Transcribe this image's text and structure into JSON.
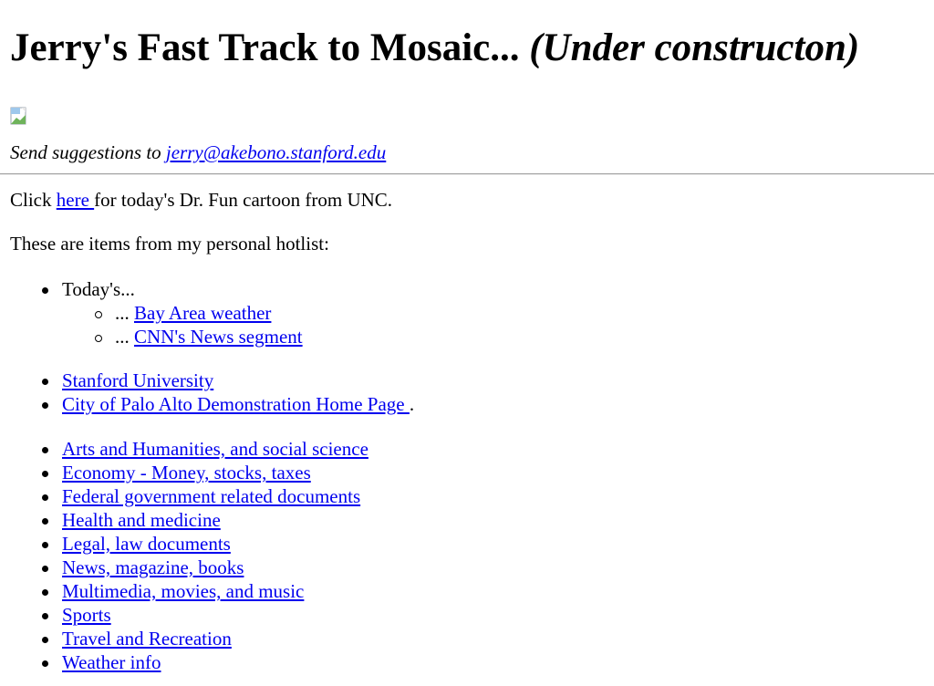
{
  "header": {
    "title_main": "Jerry's Fast Track to Mosaic...",
    "title_sub": "(Under constructon)"
  },
  "image": {
    "icon": "broken-image-icon"
  },
  "suggest": {
    "prefix": "Send suggestions to ",
    "email": "jerry@akebono.stanford.edu"
  },
  "cartoon": {
    "prefix": "Click ",
    "link": "here ",
    "suffix": "for today's Dr. Fun cartoon from UNC."
  },
  "hotlist_intro": "These are items from my personal hotlist:",
  "today": {
    "label": "Today's...",
    "items": [
      {
        "prefix": "... ",
        "link": "Bay Area weather"
      },
      {
        "prefix": "... ",
        "link": "CNN's News segment"
      }
    ]
  },
  "local": [
    {
      "link": "Stanford University",
      "suffix": ""
    },
    {
      "link": "City of Palo Alto Demonstration Home Page ",
      "suffix": "."
    }
  ],
  "categories": [
    "Arts and Humanities, and social science",
    "Economy - Money, stocks, taxes",
    "Federal government related documents",
    "Health and medicine",
    "Legal, law documents",
    "News, magazine, books",
    "Multimedia, movies, and music",
    "Sports",
    "Travel and Recreation",
    "Weather info"
  ]
}
